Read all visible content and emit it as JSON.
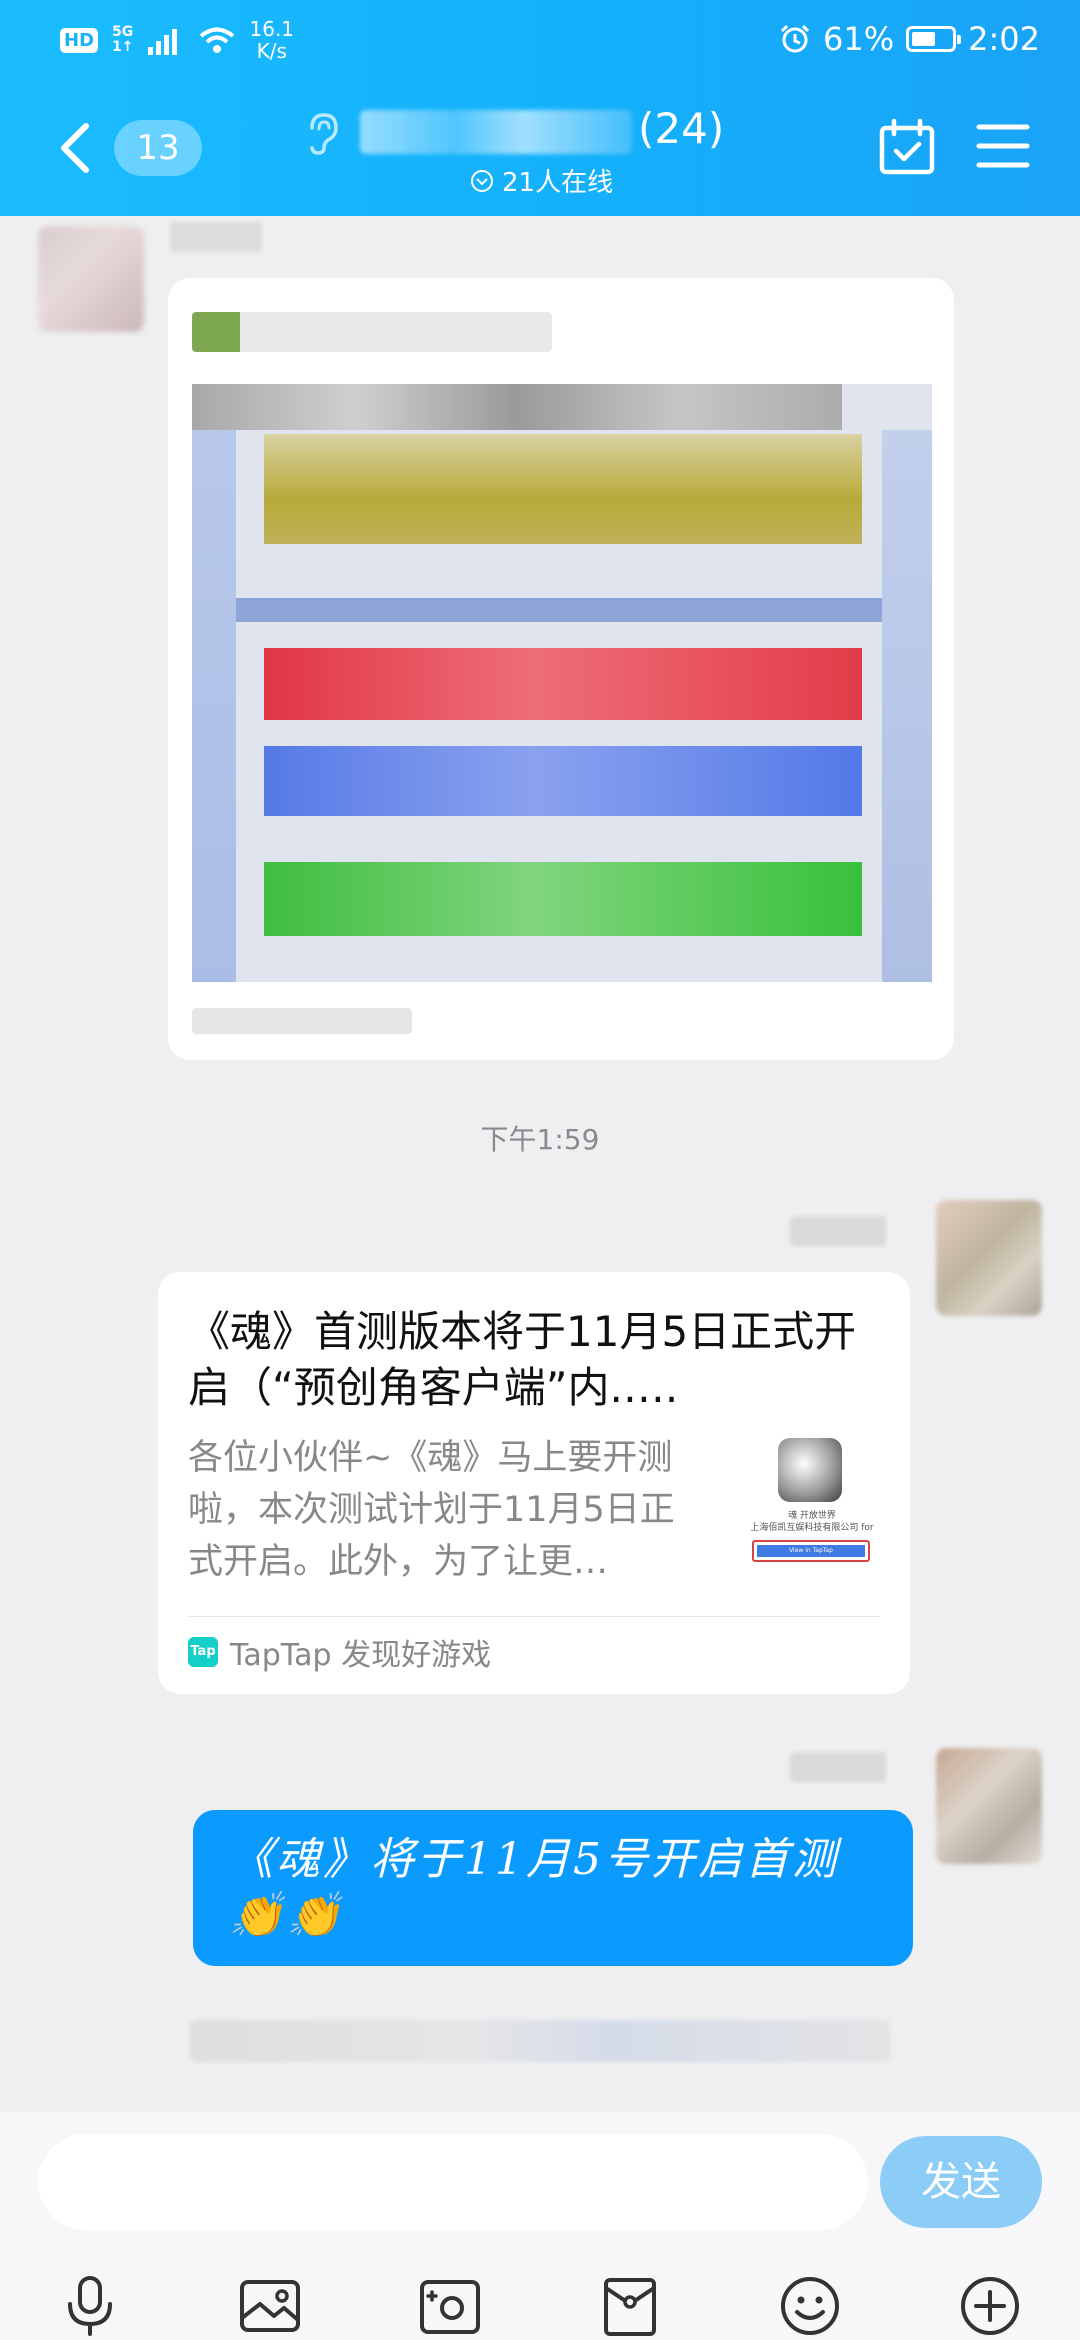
{
  "status_bar": {
    "hd": "HD",
    "network_top": "5G",
    "network_bottom": "1↑",
    "speed_value": "16.1",
    "speed_unit": "K/s",
    "battery": "61%",
    "battery_level": 0.61,
    "time": "2:02"
  },
  "header": {
    "unread_count": "13",
    "member_count": "(24)",
    "online_text": "21人在线"
  },
  "messages": {
    "timestamp": "下午1:59",
    "link_card": {
      "title": "《魂》首测版本将于11月5日正式开启（“预创角客户端”内.….",
      "description": "各位小伙伴~《魂》马上要开测啦，本次测试计划于11月5日正式开启。此外，为了让更…",
      "thumb_caption_1": "魂 开放世界",
      "thumb_caption_2": "上海佰凯互娱科技有限公司 for ",
      "thumb_button": "View in TapTap",
      "source_icon": "Tap",
      "source": "TapTap 发现好游戏"
    },
    "text_bubble": "《魂》将于11月5号开启首测👏👏"
  },
  "input": {
    "send_label": "发送"
  },
  "colors": {
    "header_gradient_start": "#1bbcff",
    "header_gradient_end": "#1aa3f7",
    "bubble_blue": "#0b9bff",
    "send_button": "#8bcdf7"
  }
}
